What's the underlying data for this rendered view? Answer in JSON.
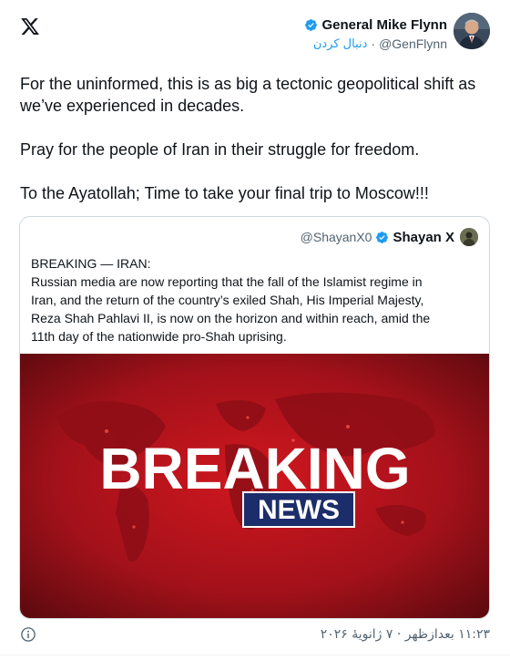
{
  "tweet": {
    "author": {
      "display_name": "General Mike Flynn",
      "handle": "@GenFlynn",
      "follow_label": "دنبال کردن",
      "separator": "·",
      "verified_color": "#1d9bf0"
    },
    "text_lines": [
      "For the uninformed, this is as big a tectonic geopolitical shift as we’ve experienced in decades.",
      "Pray for the people of Iran in their struggle for freedom.",
      "To the Ayatollah; Time to take your final trip to Moscow!!!"
    ],
    "timestamp": "۱۱:۲۳ بعدازظهر · ۷ ژانویهٔ ۲۰۲۶"
  },
  "quote": {
    "author": {
      "display_name": "Shayan X",
      "handle": "@ShayanX0"
    },
    "text_lines": [
      "BREAKING — IRAN:",
      "Russian media are now reporting that the fall of the Islamist regime in",
      "Iran, and the return of the country’s exiled Shah, His Imperial Majesty,",
      "Reza Shah Pahlavi II, is now on the horizon and within reach, amid the",
      "11th day of the nationwide pro-Shah uprising."
    ],
    "image": {
      "headline": "BREAKING",
      "subline": "NEWS",
      "background_color": "#b0121b",
      "badge_color": "#1c2d6b"
    }
  },
  "icons": {
    "logo": "x-logo-icon",
    "verified": "verified-badge-icon",
    "info": "info-icon"
  }
}
